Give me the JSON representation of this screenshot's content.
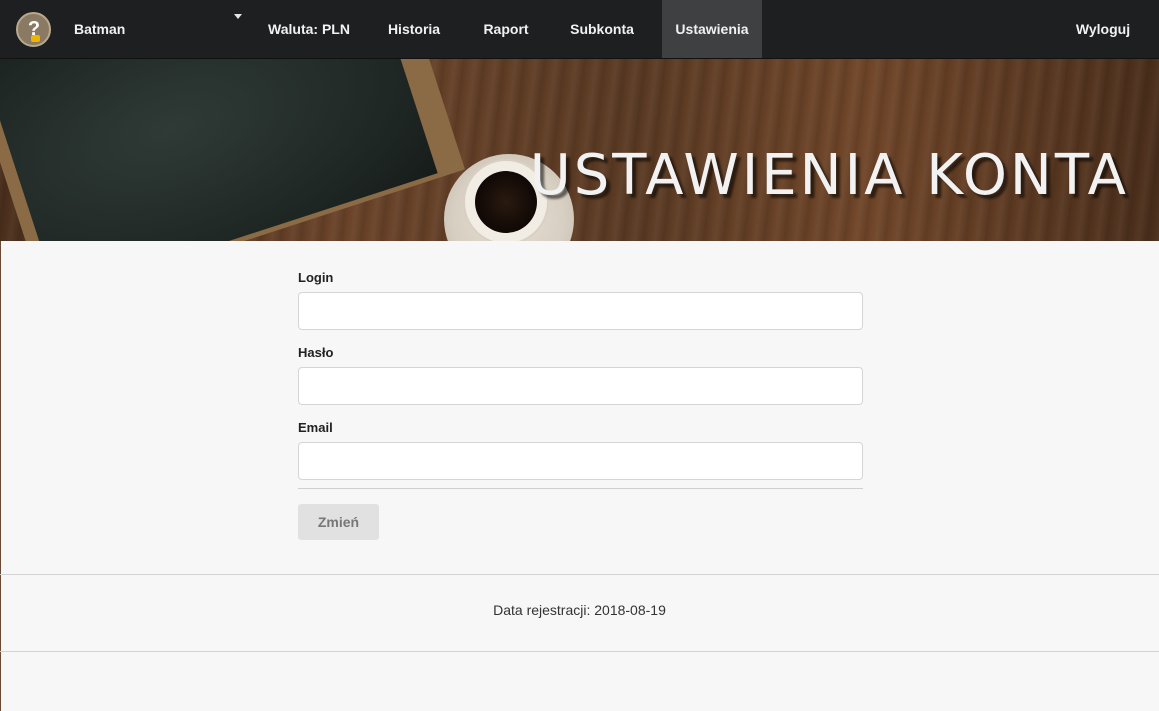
{
  "navbar": {
    "user_name": "Batman",
    "items": [
      {
        "label": "Waluta: PLN"
      },
      {
        "label": "Historia"
      },
      {
        "label": "Raport"
      },
      {
        "label": "Subkonta"
      },
      {
        "label": "Ustawienia",
        "active": true
      }
    ],
    "logout_label": "Wyloguj",
    "avatar_icon": "question-mark-avatar-icon",
    "dropdown_icon": "caret-down-icon"
  },
  "hero": {
    "title": "USTAWIENIA KONTA"
  },
  "form": {
    "login": {
      "label": "Login",
      "value": ""
    },
    "password": {
      "label": "Hasło",
      "value": ""
    },
    "email": {
      "label": "Email",
      "value": ""
    },
    "submit_label": "Zmień"
  },
  "footer": {
    "registration_text": "Data rejestracji: 2018-08-19"
  },
  "colors": {
    "navbar_bg": "#1e1f21",
    "nav_active_bg": "#3f4042",
    "page_bg": "#f7f7f7",
    "button_bg": "#e1e1e1"
  }
}
